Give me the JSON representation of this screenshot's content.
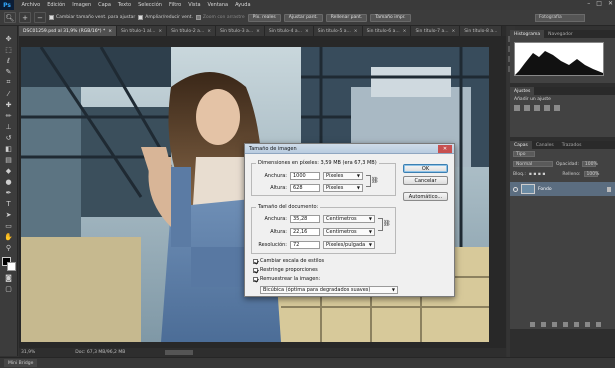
{
  "app": {
    "logo": "Ps"
  },
  "menu": [
    "Archivo",
    "Edición",
    "Imagen",
    "Capa",
    "Texto",
    "Selección",
    "Filtro",
    "Vista",
    "Ventana",
    "Ayuda"
  ],
  "window_controls": [
    "–",
    "□",
    "✕"
  ],
  "options_bar": {
    "resize_windows": "Cambiar tamaño vent. para ajustar",
    "zoom_all": "Ampliar/reducir vent.",
    "scrubby_zoom": "Zoom con arrastre",
    "actual_pixels": "Píx. reales",
    "fit_screen": "Ajustar pant.",
    "fill_screen": "Rellenar pant.",
    "print_size": "Tamaño impr.",
    "workspace": "Fotografía"
  },
  "tabs": [
    {
      "label": "DSC01259.psd al 31,9% (RGB/16*) *",
      "active": true
    },
    {
      "label": "Sin título-1 al...",
      "active": false
    },
    {
      "label": "Sin título-2 a...",
      "active": false
    },
    {
      "label": "Sin título-3 a...",
      "active": false
    },
    {
      "label": "Sin título-4 a...",
      "active": false
    },
    {
      "label": "Sin título-5 a...",
      "active": false
    },
    {
      "label": "Sin título-6 a...",
      "active": false
    },
    {
      "label": "Sin título-7 a...",
      "active": false
    },
    {
      "label": "Sin título-8 a...",
      "active": false
    }
  ],
  "status": {
    "zoom": "31,9%",
    "doc": "Doc: 67,3 MB/96,2 MB"
  },
  "bottom_panel": {
    "tab": "Mini Bridge"
  },
  "panels": {
    "histogram_tabs": [
      "Histograma",
      "Navegador"
    ],
    "adjust_tabs": [
      "Ajustes"
    ],
    "adjust_title": "Añadir un ajuste",
    "layers_tabs": [
      "Capas",
      "Canales",
      "Trazados"
    ],
    "kind_label": "Tipo",
    "blend_mode": "Normal",
    "opacity_label": "Opacidad:",
    "opacity_value": "100%",
    "lock_label": "Bloq.:",
    "fill_label": "Relleno:",
    "fill_value": "100%",
    "layer_name": "Fondo"
  },
  "dialog": {
    "title": "Tamaño de imagen",
    "pixel_dims_label": "Dimensiones en píxeles: 3,59 MB (era 67,3 MB)",
    "width_label": "Anchura:",
    "width_value": "1000",
    "width_unit": "Píxeles",
    "height_label": "Altura:",
    "height_value": "628",
    "height_unit": "Píxeles",
    "doc_size_label": "Tamaño del documento:",
    "doc_width_label": "Anchura:",
    "doc_width_value": "35,28",
    "doc_width_unit": "Centímetros",
    "doc_height_label": "Altura:",
    "doc_height_value": "22,16",
    "doc_height_unit": "Centímetros",
    "resolution_label": "Resolución:",
    "resolution_value": "72",
    "resolution_unit": "Píxeles/pulgada",
    "scale_styles": "Cambiar escala de estilos",
    "constrain": "Restringe proporciones",
    "resample": "Remuestrear la imagen:",
    "resample_method": "Bicúbica (óptima para degradados suaves)",
    "ok": "OK",
    "cancel": "Cancelar",
    "auto": "Automático..."
  }
}
